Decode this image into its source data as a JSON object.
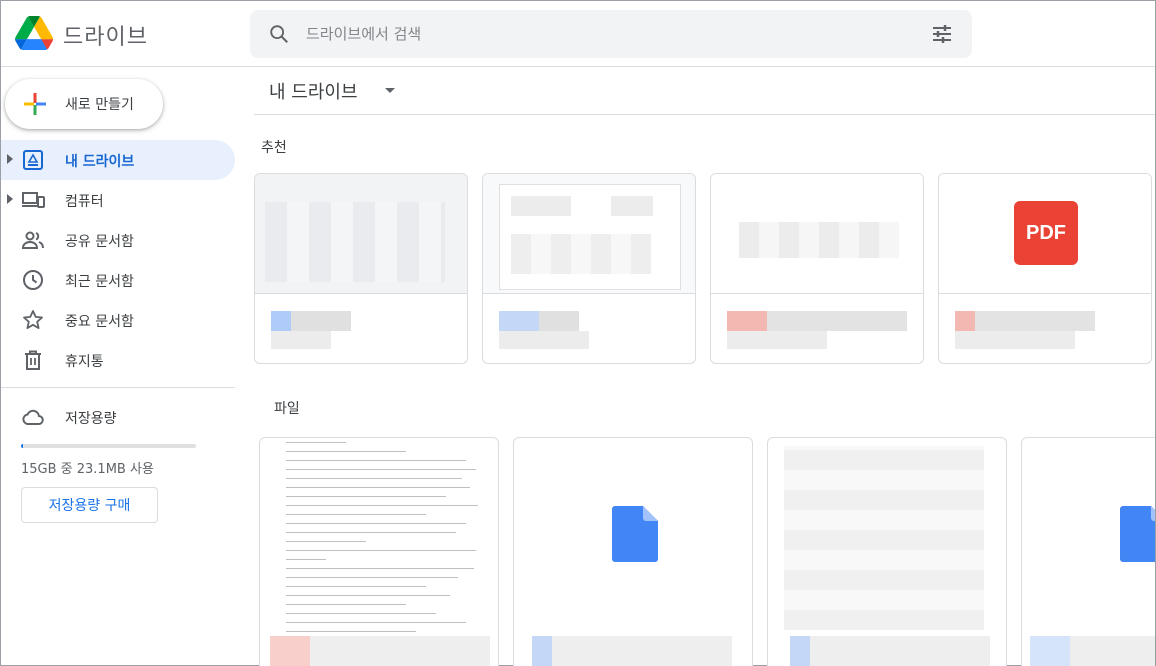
{
  "app": {
    "title": "드라이브",
    "logo_icon": "google-drive-logo"
  },
  "search": {
    "placeholder": "드라이브에서 검색",
    "search_icon": "search-icon",
    "options_icon": "tune-icon"
  },
  "sidebar": {
    "new_button_label": "새로 만들기",
    "items": [
      {
        "label": "내 드라이브",
        "icon": "my-drive-icon",
        "active": true,
        "expandable": true
      },
      {
        "label": "컴퓨터",
        "icon": "computers-icon",
        "active": false,
        "expandable": true
      },
      {
        "label": "공유 문서함",
        "icon": "people-icon",
        "active": false,
        "expandable": false
      },
      {
        "label": "최근 문서함",
        "icon": "clock-icon",
        "active": false,
        "expandable": false
      },
      {
        "label": "중요 문서함",
        "icon": "star-icon",
        "active": false,
        "expandable": false
      },
      {
        "label": "휴지통",
        "icon": "trash-icon",
        "active": false,
        "expandable": false
      }
    ],
    "storage": {
      "label": "저장용량",
      "icon": "cloud-icon",
      "usage_text": "15GB 중 23.1MB 사용",
      "used_fraction": 0.0015,
      "buy_button_label": "저장용량 구매"
    }
  },
  "main": {
    "breadcrumb": "내 드라이브",
    "suggested_title": "추천",
    "files_title": "파일",
    "suggested_badge": "PDF"
  },
  "colors": {
    "accent": "#1a73e8",
    "active_bg": "#e8f0fe",
    "pdf_red": "#ea4335",
    "doc_blue": "#4285f4"
  }
}
